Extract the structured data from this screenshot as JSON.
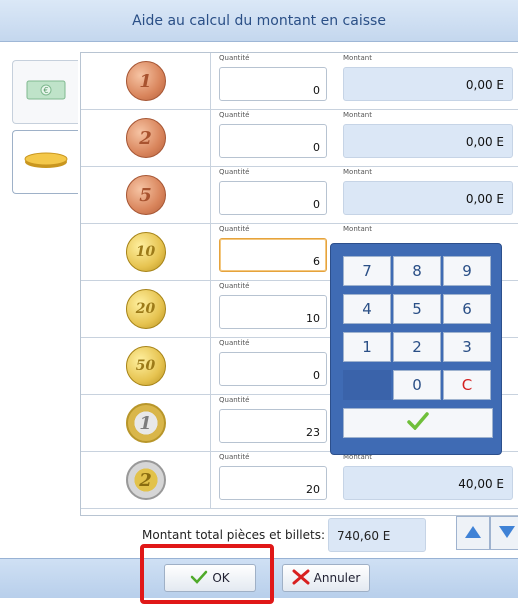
{
  "window": {
    "title": "Aide au calcul du montant en caisse"
  },
  "labels": {
    "quantity": "Quantité",
    "amount": "Montant"
  },
  "rows": [
    {
      "coin": "coin-1-cent-icon",
      "coin_text": "1",
      "quantity": "0",
      "amount": "0,00 E"
    },
    {
      "coin": "coin-2-cent-icon",
      "coin_text": "2",
      "quantity": "0",
      "amount": "0,00 E"
    },
    {
      "coin": "coin-5-cent-icon",
      "coin_text": "5",
      "quantity": "0",
      "amount": "0,00 E"
    },
    {
      "coin": "coin-10-cent-icon",
      "coin_text": "10",
      "quantity": "6",
      "amount": ""
    },
    {
      "coin": "coin-20-cent-icon",
      "coin_text": "20",
      "quantity": "10",
      "amount": ""
    },
    {
      "coin": "coin-50-cent-icon",
      "coin_text": "50",
      "quantity": "0",
      "amount": ""
    },
    {
      "coin": "coin-1-euro-icon",
      "coin_text": "1",
      "quantity": "23",
      "amount": ""
    },
    {
      "coin": "coin-2-euro-icon",
      "coin_text": "2",
      "quantity": "20",
      "amount": "40,00 E"
    }
  ],
  "numpad": {
    "keys": [
      "7",
      "8",
      "9",
      "4",
      "5",
      "6",
      "1",
      "2",
      "3",
      "",
      "0",
      "C"
    ]
  },
  "footer": {
    "total_label": "Montant total pièces et billets:",
    "total_value": "740,60 E",
    "ok_label": "OK",
    "cancel_label": "Annuler"
  },
  "tabs": [
    {
      "icon": "banknote-icon",
      "active": false
    },
    {
      "icon": "coin-stack-icon",
      "active": true
    }
  ],
  "colors": {
    "accent": "#3f6bb4",
    "highlight": "#e01818",
    "title": "#2a4f86"
  }
}
